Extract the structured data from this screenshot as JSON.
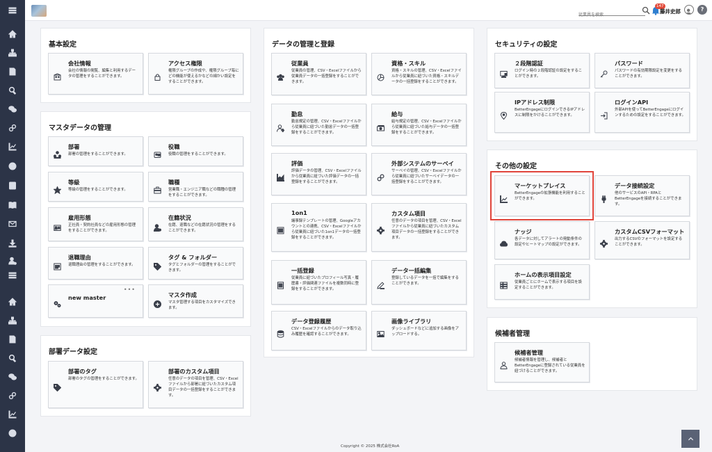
{
  "header": {
    "search_placeholder": "従業員を検索",
    "notification_count": "147",
    "user_name": "藤井史郎",
    "help_label": "?"
  },
  "sidebar_icons": [
    "menu-icon",
    "home-icon",
    "org-chart-icon",
    "document-icon",
    "search-icon",
    "chat-icon",
    "link-icon",
    "chart-icon",
    "info-icon",
    "profile-icon",
    "book-icon",
    "mail-icon",
    "download-icon",
    "user-settings-icon",
    "menu-icon",
    "home-icon",
    "org-chart-icon",
    "document-icon",
    "search-icon",
    "chat-icon",
    "link-icon",
    "chart-icon",
    "info-icon"
  ],
  "sections": {
    "basic": {
      "title": "基本設定",
      "tiles": [
        {
          "title": "会社情報",
          "desc": "会社の情報の閲覧、編集と利用するデータの管理をすることができます。",
          "icon": "building-icon"
        },
        {
          "title": "アクセス権限",
          "desc": "権限グループの作成や、権限グループ毎にどの機能が使えるかなどの細かい設定をすることができます。",
          "icon": "lock-icon"
        }
      ]
    },
    "master": {
      "title": "マスタデータの管理",
      "tiles": [
        {
          "title": "部署",
          "desc": "部署の管理をすることができます。",
          "icon": "org-icon"
        },
        {
          "title": "役職",
          "desc": "役職の管理をすることができます。",
          "icon": "badge-icon"
        },
        {
          "title": "等級",
          "desc": "等級の管理をすることができます。",
          "icon": "star-icon"
        },
        {
          "title": "職種",
          "desc": "営業職・エンジニア職などの職種の管理をすることができます。",
          "icon": "briefcase-icon"
        },
        {
          "title": "雇用形態",
          "desc": "正社員・契約社員などの雇用形態の管理をすることができます。",
          "icon": "id-card-icon"
        },
        {
          "title": "在籍状況",
          "desc": "在籍、退職などの在籍状況の管理をすることができます。",
          "icon": "user-status-icon"
        },
        {
          "title": "退職理由",
          "desc": "退職理由の管理をすることができます。",
          "icon": "exit-icon"
        },
        {
          "title": "タグ & フォルダー",
          "desc": "タグとフォルダーの管理をすることができます。",
          "icon": "tag-icon"
        },
        {
          "title": "new master",
          "desc": "",
          "icon": "gears-icon",
          "more": "•••"
        },
        {
          "title": "マスタ作成",
          "desc": "マスタ管理する項目をカスタマイズできます。",
          "icon": "plus-circle-icon"
        }
      ]
    },
    "dept": {
      "title": "部署データ設定",
      "tiles": [
        {
          "title": "部署のタグ",
          "desc": "部署のタグの管理をすることができます。",
          "icon": "tag-icon"
        },
        {
          "title": "部署のカスタム項目",
          "desc": "任意のデータの項目を管理、CSV・Excelファイルから部署に紐づいたカスタム項目データの一括登録をすることができます。",
          "icon": "gear-icon"
        }
      ]
    },
    "data": {
      "title": "データの管理と登録",
      "tiles": [
        {
          "title": "従業員",
          "desc": "従業員の管理、CSV・Excelファイルから従業員データの一括登録をすることができます。",
          "icon": "users-icon"
        },
        {
          "title": "資格・スキル",
          "desc": "資格・スキルの管理、CSV・Excelファイルから従業員に紐づいた資格・スキルデータの一括登録をすることができます。",
          "icon": "skill-icon"
        },
        {
          "title": "勤怠",
          "desc": "勤怠規定の管理、CSV・Excelファイルから従業員に紐づいた勤怠データの一括登録をすることができます。",
          "icon": "user-plus-icon"
        },
        {
          "title": "給与",
          "desc": "給与規定の管理、CSV・Excelファイルから従業員に紐づいた給与データの一括登録をすることができます。",
          "icon": "money-icon"
        },
        {
          "title": "評価",
          "desc": "評価データの管理、CSV・Excelファイルから従業員に紐づいた評価データの一括登録をすることができます。",
          "icon": "area-chart-icon"
        },
        {
          "title": "外部システムのサーベイ",
          "desc": "サーベイの管理、CSV・Excelファイルから従業員に紐づいたサーベイデータの一括登録をすることができます。",
          "icon": "link-icon"
        },
        {
          "title": "1on1",
          "desc": "議事録テンプレートの管理、Googleアカウントとの連携、CSV・Excelファイルから従業員に紐づいた1on1データの一括登録をすることができます。",
          "icon": "list-icon"
        },
        {
          "title": "カスタム項目",
          "desc": "任意のデータの項目を管理、CSV・Excelファイルから従業員に紐づいたカスタム項目データの一括登録をすることができます。",
          "icon": "gear-icon"
        },
        {
          "title": "一括登録",
          "desc": "従業員に紐づいたプロフィール写真・履歴書・評価関連ファイルを複数同時に登録をすることができます。",
          "icon": "stack-icon"
        },
        {
          "title": "データ一括編集",
          "desc": "登録しているデータを一括で編集をすることができます。",
          "icon": "pencil-icon"
        },
        {
          "title": "データ登録履歴",
          "desc": "CSV・Excelファイルからのデータ取り込み履歴を確認することができます。",
          "icon": "database-icon"
        },
        {
          "title": "画像ライブラリ",
          "desc": "ダッシュボードなどに追加する画像をアップロードする。",
          "icon": "image-icon"
        }
      ]
    },
    "security": {
      "title": "セキュリティの設定",
      "tiles": [
        {
          "title": "２段階認証",
          "desc": "ログイン時の２段階認証の設定をすることができます。",
          "icon": "monitor-icon"
        },
        {
          "title": "パスワード",
          "desc": "パスワードの有効期限設定を変更をすることができます。",
          "icon": "key-icon"
        },
        {
          "title": "IPアドレス制限",
          "desc": "BetterEngageにログインできるIPアドレスに制限をかけることができます。",
          "icon": "location-icon"
        },
        {
          "title": "ログインAPI",
          "desc": "外部APIを使ってBetterEngageにログインするための設定をすることができます。",
          "icon": "login-icon"
        }
      ]
    },
    "other": {
      "title": "その他の設定",
      "tiles": [
        {
          "title": "マーケットプレイス",
          "desc": "BetterEngageの拡張機能を利用することができます。",
          "icon": "trend-icon"
        },
        {
          "title": "データ接続設定",
          "desc": "他のサービスのAPI・RPAとBetterEngageを接続することができます。",
          "icon": "plug-icon"
        },
        {
          "title": "ナッジ",
          "desc": "各データに対してアラートの発動条件の設定やヒートマップの設定ができます。",
          "icon": "cloud-icon"
        },
        {
          "title": "カスタムCSVフォーマット",
          "desc": "出力するCSVのフォーマットを設定することができます。",
          "icon": "gear-icon"
        },
        {
          "title": "ホームの表示項目設定",
          "desc": "従業員ごとにホームで表示する項目を設定することができます。",
          "icon": "table-icon"
        }
      ]
    },
    "candidate": {
      "title": "候補者管理",
      "tiles": [
        {
          "title": "候補者管理",
          "desc": "候補者情報を管理し、候補者とBetterEngageに登録されている従業員を紐づけることができます。",
          "icon": "candidate-icon"
        }
      ]
    }
  },
  "footer": {
    "copyright": "Copyright © 2025 株式会社RoA"
  }
}
